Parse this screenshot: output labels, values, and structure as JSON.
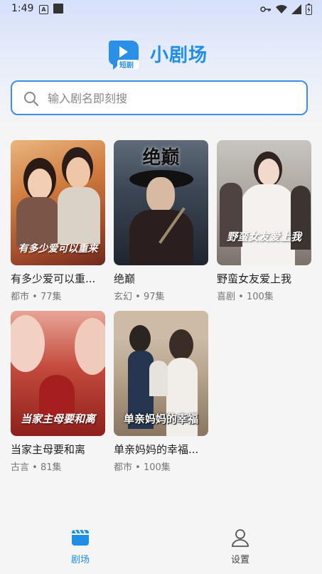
{
  "status_bar": {
    "time": "1:49"
  },
  "header": {
    "app_title": "小剧场",
    "logo_badge": "短剧"
  },
  "search": {
    "placeholder": "输入剧名即刻搜",
    "value": ""
  },
  "dramas": [
    {
      "poster_title": "有多少爱可以重来",
      "name": "有多少爱可以重...",
      "genre": "都市",
      "episodes": "77集"
    },
    {
      "poster_title": "绝巅",
      "name": "绝巅",
      "genre": "玄幻",
      "episodes": "97集"
    },
    {
      "poster_title": "野蛮女友爱上我",
      "name": "野蛮女友爱上我",
      "genre": "喜剧",
      "episodes": "100集"
    },
    {
      "poster_title": "当家主母要和离",
      "name": "当家主母要和离",
      "genre": "古言",
      "episodes": "81集"
    },
    {
      "poster_title": "单亲妈妈的幸福",
      "name": "单亲妈妈的幸福...",
      "genre": "都市",
      "episodes": "100集"
    }
  ],
  "meta_separator": "•",
  "bottom_nav": [
    {
      "label": "剧场",
      "active": true,
      "icon": "theater-icon"
    },
    {
      "label": "设置",
      "active": false,
      "icon": "user-icon"
    }
  ],
  "colors": {
    "accent": "#1f8ee8",
    "search_border": "#3a8ee6"
  }
}
